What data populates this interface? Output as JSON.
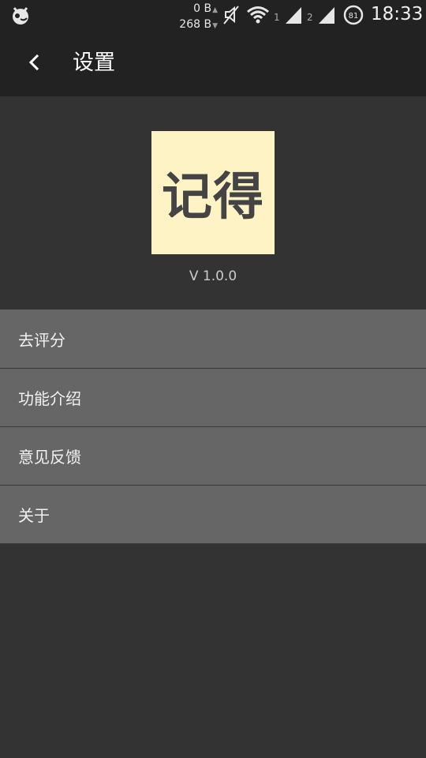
{
  "status_bar": {
    "net_up": "0 B",
    "net_down": "268 B",
    "sim1": "1",
    "sim2": "2",
    "battery": "81",
    "time": "18:33",
    "icons": [
      "app-notification-icon",
      "mute-icon",
      "wifi-icon",
      "signal-icon",
      "signal-icon",
      "battery-icon"
    ]
  },
  "toolbar": {
    "back_icon": "chevron-left-icon",
    "title": "设置"
  },
  "header": {
    "logo_text": "记得",
    "logo_bg": "#fdf3c4",
    "version": "V 1.0.0"
  },
  "menu": {
    "items": [
      {
        "label": "去评分"
      },
      {
        "label": "功能介绍"
      },
      {
        "label": "意见反馈"
      },
      {
        "label": "关于"
      }
    ]
  }
}
